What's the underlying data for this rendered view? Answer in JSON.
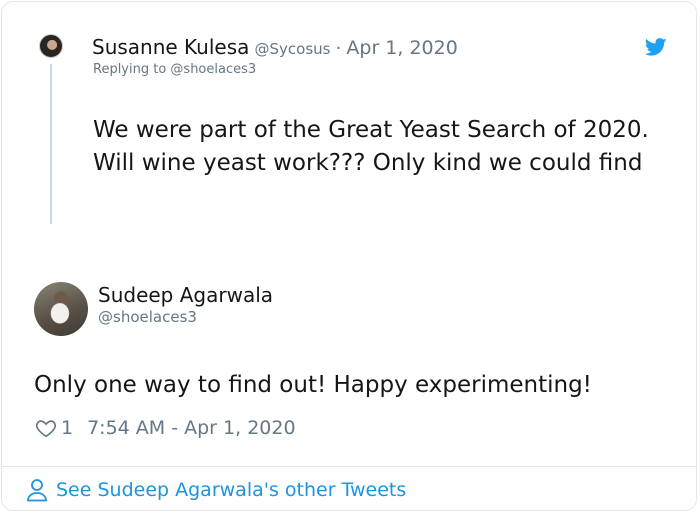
{
  "reply_tweet": {
    "author_name": "Susanne Kulesa",
    "author_handle": "@Sycosus",
    "separator": "·",
    "date": "Apr 1, 2020",
    "replying_to": "Replying to @shoelaces3",
    "text": "We were part of the Great Yeast Search of 2020. Will wine yeast work??? Only kind we could find"
  },
  "main_tweet": {
    "author_name": "Sudeep Agarwala",
    "author_handle": "@shoelaces3",
    "text": "Only one way to find out! Happy experimenting!",
    "like_count": "1",
    "timestamp": "7:54 AM - Apr 1, 2020"
  },
  "footer": {
    "link_label": "See Sudeep Agarwala's other Tweets"
  },
  "icons": {
    "brand": "twitter-bird-icon",
    "like": "heart-icon",
    "profile": "person-icon"
  },
  "colors": {
    "twitter_blue": "#1da1f2",
    "link_blue": "#1b95e0",
    "secondary_text": "#657786",
    "primary_text": "#14171a",
    "border": "#e1e8ed"
  }
}
